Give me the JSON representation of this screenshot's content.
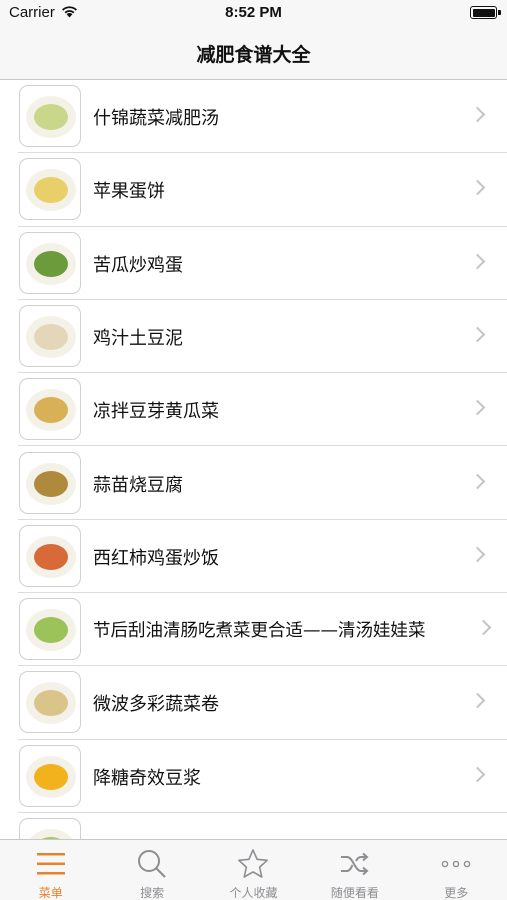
{
  "status_bar": {
    "carrier": "Carrier",
    "time": "8:52 PM"
  },
  "nav": {
    "title": "减肥食谱大全"
  },
  "recipes": [
    {
      "title": "什锦蔬菜减肥汤",
      "thumb_color": "#c9d78a"
    },
    {
      "title": "苹果蛋饼",
      "thumb_color": "#e8cf6a"
    },
    {
      "title": "苦瓜炒鸡蛋",
      "thumb_color": "#6b9b3a"
    },
    {
      "title": "鸡汁土豆泥",
      "thumb_color": "#e4d6b8"
    },
    {
      "title": "凉拌豆芽黄瓜菜",
      "thumb_color": "#d8b055"
    },
    {
      "title": "蒜苗烧豆腐",
      "thumb_color": "#b08a3c"
    },
    {
      "title": "西红柿鸡蛋炒饭",
      "thumb_color": "#d86a3a"
    },
    {
      "title": "节后刮油清肠吃煮菜更合适——清汤娃娃菜",
      "thumb_color": "#9cc25a"
    },
    {
      "title": "微波多彩蔬菜卷",
      "thumb_color": "#d9c48a"
    },
    {
      "title": "降糖奇效豆浆",
      "thumb_color": "#f2b21e"
    },
    {
      "title": "",
      "thumb_color": "#a9c86a"
    }
  ],
  "tabs": [
    {
      "label": "菜单",
      "icon": "menu-icon",
      "active": true
    },
    {
      "label": "搜索",
      "icon": "search-icon",
      "active": false
    },
    {
      "label": "个人收藏",
      "icon": "star-icon",
      "active": false
    },
    {
      "label": "随便看看",
      "icon": "shuffle-icon",
      "active": false
    },
    {
      "label": "更多",
      "icon": "more-icon",
      "active": false
    }
  ],
  "colors": {
    "accent": "#e8822c",
    "inactive": "#8e8e93",
    "chevron": "#c4c4c8"
  }
}
